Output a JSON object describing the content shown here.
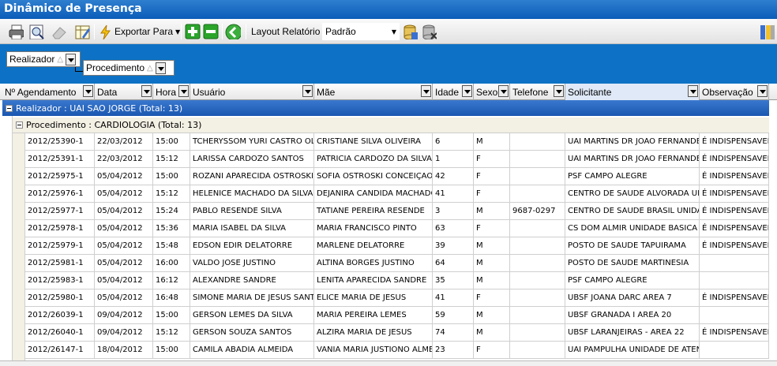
{
  "window": {
    "title": "Dinâmico de Presença"
  },
  "toolbar": {
    "export_label": "Exportar Para",
    "layout_label": "Layout Relatório",
    "layout_value": "Padrão"
  },
  "group_panel": {
    "chip1": "Realizador",
    "chip2": "Procedimento"
  },
  "columns": [
    "Nº Agendamento",
    "Data",
    "Hora",
    "Usuário",
    "Mãe",
    "Idade",
    "Sexo",
    "Telefone",
    "Solicitante",
    "Observação"
  ],
  "group1": "Realizador : UAI SAO JORGE (Total: 13)",
  "group2": "Procedimento : CARDIOLOGIA (Total: 13)",
  "rows": [
    [
      "2012/25390-1",
      "22/03/2012",
      "15:00",
      "TCHERYSSOM YURI CASTRO OLI",
      "CRISTIANE SILVA OLIVEIRA",
      "6",
      "M",
      "",
      "UAI MARTINS DR JOAO FERNANDES",
      "É INDISPENSAVEL"
    ],
    [
      "2012/25391-1",
      "22/03/2012",
      "15:12",
      "LARISSA CARDOZO SANTOS",
      "PATRICIA CARDOZO DA SILVA",
      "1",
      "F",
      "",
      "UAI MARTINS DR JOAO FERNANDES",
      "É INDISPENSAVEL"
    ],
    [
      "2012/25975-1",
      "05/04/2012",
      "15:00",
      "ROZANI APARECIDA OSTROSKI C",
      "SOFIA OSTROSKI CONCEIÇAO",
      "42",
      "F",
      "",
      "PSF CAMPO ALEGRE",
      "É INDISPENSAVEL"
    ],
    [
      "2012/25976-1",
      "05/04/2012",
      "15:12",
      "HELENICE MACHADO DA SILVA",
      "DEJANIRA CANDIDA MACHADO",
      "41",
      "F",
      "",
      "CENTRO DE SAUDE ALVORADA UNI",
      "É INDISPENSAVEL"
    ],
    [
      "2012/25977-1",
      "05/04/2012",
      "15:24",
      "PABLO RESENDE SILVA",
      "TATIANE PEREIRA RESENDE",
      "3",
      "M",
      "9687-0297",
      "CENTRO DE SAUDE BRASIL UNIDAD",
      "É INDISPENSAVEL"
    ],
    [
      "2012/25978-1",
      "05/04/2012",
      "15:36",
      "MARIA ISABEL DA SILVA",
      "MARIA FRANCISCO PINTO",
      "63",
      "F",
      "",
      "CS DOM ALMIR UNIDADE BASICA D",
      "É INDISPENSAVEL"
    ],
    [
      "2012/25979-1",
      "05/04/2012",
      "15:48",
      "EDSON EDIR DELATORRE",
      "MARLENE DELATORRE",
      "39",
      "M",
      "",
      "POSTO DE SAUDE TAPUIRAMA",
      "É INDISPENSAVEL"
    ],
    [
      "2012/25981-1",
      "05/04/2012",
      "16:00",
      "VALDO JOSE JUSTINO",
      "ALTINA BORGES JUSTINO",
      "64",
      "M",
      "",
      "POSTO DE SAUDE MARTINESIA",
      ""
    ],
    [
      "2012/25983-1",
      "05/04/2012",
      "16:12",
      "ALEXANDRE SANDRE",
      "LENITA APARECIDA SANDRE",
      "35",
      "M",
      "",
      "PSF CAMPO ALEGRE",
      ""
    ],
    [
      "2012/25980-1",
      "05/04/2012",
      "16:48",
      "SIMONE MARIA DE JESUS SANTO",
      "ELICE MARIA DE JESUS",
      "41",
      "F",
      "",
      "UBSF JOANA DARC AREA 7",
      "É INDISPENSAVEL"
    ],
    [
      "2012/26039-1",
      "09/04/2012",
      "15:00",
      "GERSON LEMES DA SILVA",
      "MARIA PEREIRA LEMES",
      "59",
      "M",
      "",
      "UBSF GRANADA I AREA 20",
      ""
    ],
    [
      "2012/26040-1",
      "09/04/2012",
      "15:12",
      "GERSON SOUZA SANTOS",
      "ALZIRA MARIA DE JESUS",
      "74",
      "M",
      "",
      "UBSF LARANJEIRAS - AREA 22",
      "É INDISPENSAVEL"
    ],
    [
      "2012/26147-1",
      "18/04/2012",
      "15:00",
      "CAMILA ABADIA ALMEIDA",
      "VANIA MARIA JUSTIONO ALME",
      "23",
      "F",
      "",
      "UAI PAMPULHA UNIDADE DE ATENI",
      ""
    ]
  ]
}
